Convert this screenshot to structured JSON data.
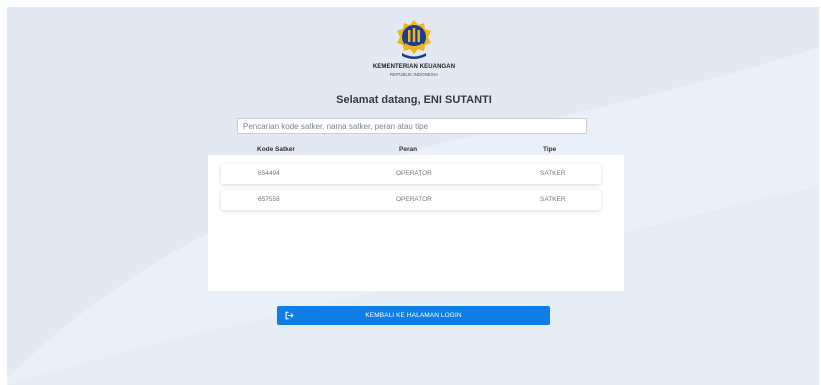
{
  "org": {
    "name": "KEMENTERIAN KEUANGAN",
    "subtitle": "REPUBLIK INDONESIA"
  },
  "welcome": "Selamat datang, ENI SUTANTI",
  "search": {
    "placeholder": "Pencarian kode satker, nama satker, peran atau tipe",
    "value": ""
  },
  "table": {
    "columns": [
      "Kode Satker",
      "Peran",
      "Tipe"
    ],
    "rows": [
      [
        "654494",
        "OPERATOR",
        "SATKER"
      ],
      [
        "657558",
        "OPERATOR",
        "SATKER"
      ]
    ]
  },
  "back_button": {
    "label": "KEMBALI KE HALAMAN LOGIN",
    "icon": "sign-out-icon"
  },
  "colors": {
    "background": "#e2e9f3",
    "accent": "#0d7ee8",
    "logo_blue": "#1b3f8f",
    "logo_gold": "#f2b418"
  }
}
